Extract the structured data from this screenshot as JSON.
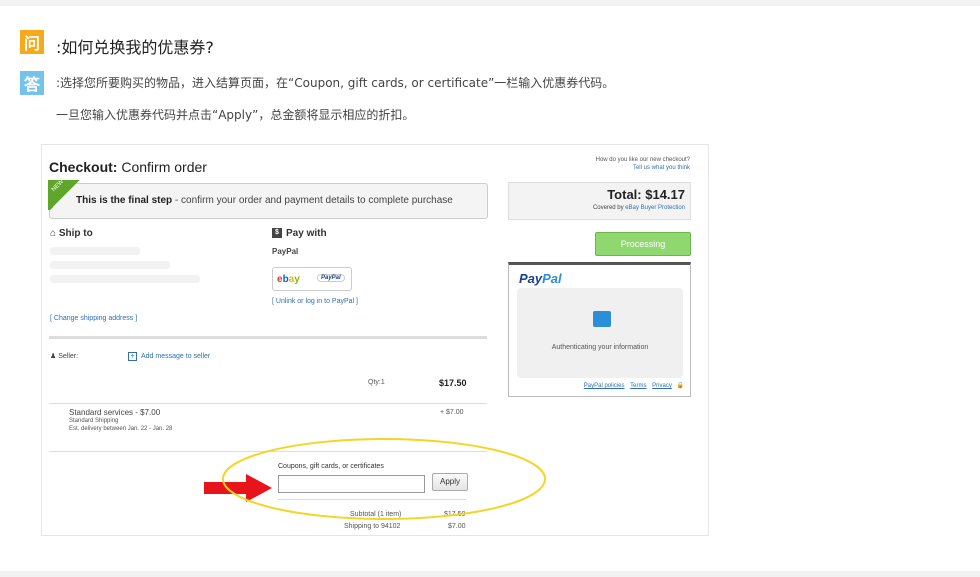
{
  "qa": {
    "q_badge": "问",
    "question": ":如何兑换我的优惠券?",
    "a_badge": "答",
    "answer_line1": ":选择您所要购买的物品，进入结算页面，在“Coupon, gift cards, or certificate”一栏输入优惠券代码。",
    "answer_line2": "一旦您输入优惠券代码并点击“Apply”，总金额将显示相应的折扣。"
  },
  "checkout": {
    "title_bold": "Checkout:",
    "title_rest": " Confirm order",
    "new_tag": "NEW",
    "final_bold": "This is the final step",
    "final_rest": " - confirm your order and payment details to complete purchase",
    "ship_to": "Ship to",
    "pay_with": "Pay with",
    "pay_method": "PayPal",
    "ebay_logo": "ebay",
    "paypal_mini": "PayPal",
    "unlink": "[ Unlink or log in to PayPal ]",
    "change_address": "[ Change shipping address ]",
    "seller_label": "Seller:",
    "add_message": "Add message to seller",
    "qty": "Qty:1",
    "item_price": "$17.50",
    "shipping_service": "Standard services - $7.00",
    "shipping_type": "Standard Shipping",
    "delivery": "Est. delivery between Jan. 22 - Jan. 28",
    "shipping_cost": "+ $7.00",
    "coupon_label": "Coupons, gift cards, or certificates",
    "coupon_value": "",
    "apply": "Apply",
    "subtotal_label": "Subtotal (1 item)",
    "subtotal_value": "$17.50",
    "shipping_to_label": "Shipping to 94102",
    "shipping_to_value": "$7.00"
  },
  "sidebar": {
    "howdo": "How do you like our new checkout?",
    "tell": "Tell us what you think",
    "total": "Total:  $14.17",
    "covered": "Covered by",
    "covered_link": "eBay Buyer Protection",
    "processing": "Processing",
    "paypal_logo_a": "Pay",
    "paypal_logo_b": "Pal",
    "authenticating": "Authenticating your information",
    "policies": "PayPal policies",
    "terms": "Terms",
    "privacy": "Privacy"
  },
  "colors": {
    "q_badge": "#f7a81b",
    "a_badge": "#74c3ec",
    "arrow": "#e8141b",
    "highlight": "#f5d423",
    "processing": "#8fd86f"
  }
}
